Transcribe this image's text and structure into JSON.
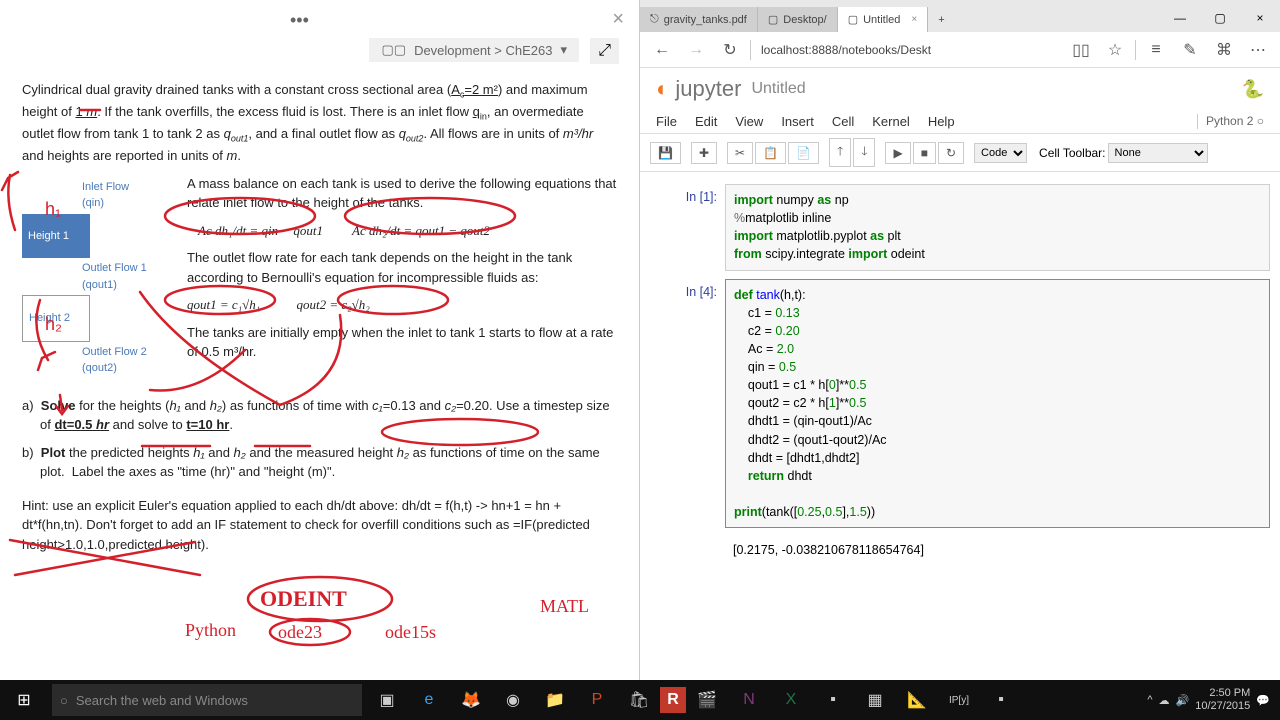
{
  "note": {
    "breadcrumb": "Development > ChE263",
    "intro": "Cylindrical dual gravity drained tanks with a constant cross sectional area (Ac=2 m²) and maximum height of 1 m. If the tank overfills, the excess fluid is lost. There is an inlet flow qin, an overmediate outlet flow from tank 1 to tank 2 as qout1, and a final outlet flow as qout2. All flows are in units of m³/hr and heights are reported in units of m.",
    "mass_balance": "A mass balance on each tank is used to derive the following equations that relate inlet flow to the height of the tanks.",
    "eq1": "Ac dh₁/dt = qin − qout1",
    "eq2": "Ac dh₂/dt = qout1 − qout2",
    "bernoulli": "The outlet flow rate for each tank depends on the height in the tank according to Bernoulli's equation for incompressible fluids as:",
    "eq3": "qout1 = c₁√h₁",
    "eq4": "qout2 = c₂√h₂",
    "initial": "The tanks are initially empty when the inlet to tank 1 starts to flow at a rate of 0.5 m³/hr.",
    "task_a": "Solve for the heights (h₁ and h₂) as functions of time with c₁=0.13 and c₂=0.20. Use a timestep size of dt=0.5 hr and solve to t=10 hr.",
    "task_b": "Plot the predicted heights h₁ and h₂ and the measured height h₂ as functions of time on the same plot.  Label the axes as \"time (hr)\" and \"height (m)\".",
    "hint": "Hint: use an explicit Euler's equation applied to each dh/dt above: dh/dt = f(h,t) -> hn+1 = hn + dt*f(hn,tn). Don't forget to add an IF statement to check for overfill conditions such as =IF(predicted height>1.0,1.0,predicted height).",
    "diagram": {
      "inlet": "Inlet Flow",
      "qin": "(qin)",
      "h1": "Height 1",
      "out1": "Outlet Flow 1",
      "qout1": "(qout1)",
      "h2": "Height 2",
      "out2": "Outlet Flow 2",
      "qout2": "(qout2)"
    },
    "handwriting": {
      "odeint": "ODEINT",
      "python": "Python",
      "ode23": "ode23",
      "ode15s": "ode15s",
      "matl": "MATL"
    }
  },
  "browser": {
    "tabs": [
      {
        "label": "gravity_tanks.pdf"
      },
      {
        "label": "Desktop/"
      },
      {
        "label": "Untitled"
      }
    ],
    "url": "localhost:8888/notebooks/Deskt",
    "notebook_title": "Untitled",
    "kernel": "Python 2",
    "menu": [
      "File",
      "Edit",
      "View",
      "Insert",
      "Cell",
      "Kernel",
      "Help"
    ],
    "celltype": "Code",
    "celltoolbar_label": "Cell Toolbar:",
    "celltoolbar": "None",
    "cells": {
      "in1_prompt": "In [1]:",
      "in4_prompt": "In [4]:",
      "out_val": "[0.2175, -0.038210678118654764]"
    }
  },
  "taskbar": {
    "search_placeholder": "Search the web and Windows",
    "time": "2:50 PM",
    "date": "10/27/2015"
  }
}
